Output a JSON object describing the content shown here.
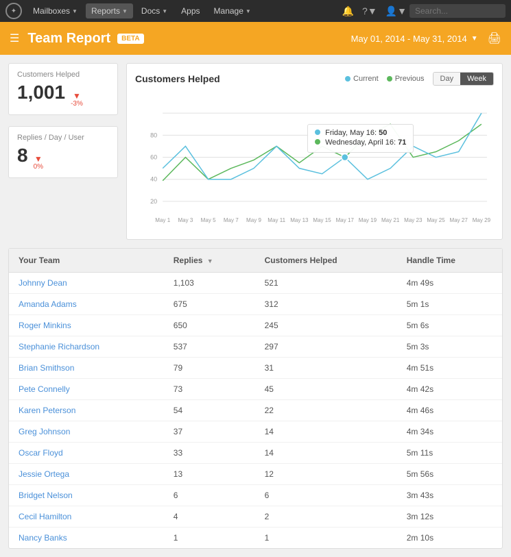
{
  "topnav": {
    "logo": "★",
    "items": [
      {
        "label": "Mailboxes",
        "arrow": true,
        "active": false
      },
      {
        "label": "Reports",
        "arrow": true,
        "active": true
      },
      {
        "label": "Docs",
        "arrow": true,
        "active": false
      },
      {
        "label": "Apps",
        "arrow": false,
        "active": false
      },
      {
        "label": "Manage",
        "arrow": true,
        "active": false
      }
    ],
    "search_placeholder": "Search..."
  },
  "subheader": {
    "title": "Team Report",
    "beta_label": "BETA",
    "date_range": "May 01, 2014 - May 31, 2014"
  },
  "stats": [
    {
      "label": "Customers Helped",
      "value": "1,001",
      "change": "-3%",
      "direction": "down"
    },
    {
      "label": "Replies / Day / User",
      "value": "8",
      "change": "0%",
      "direction": "down"
    }
  ],
  "chart": {
    "title": "Customers Helped",
    "legend": {
      "current_label": "Current",
      "previous_label": "Previous"
    },
    "toggle": {
      "day_label": "Day",
      "week_label": "Week",
      "active": "Week"
    },
    "x_labels": [
      "May 1",
      "May 3",
      "May 5",
      "May 7",
      "May 9",
      "May 11",
      "May 13",
      "May 15",
      "May 17",
      "May 19",
      "May 21",
      "May 23",
      "May 25",
      "May 27",
      "May 29"
    ],
    "y_labels": [
      "20",
      "40",
      "60",
      "80"
    ],
    "tooltip": {
      "current_label": "Friday, May 16:",
      "current_value": "50",
      "previous_label": "Wednesday, April 16:",
      "previous_value": "71"
    }
  },
  "team_table": {
    "headers": [
      "Your Team",
      "Replies",
      "Customers Helped",
      "Handle Time"
    ],
    "rows": [
      {
        "name": "Johnny Dean",
        "replies": "1,103",
        "customers": "521",
        "handle": "4m 49s"
      },
      {
        "name": "Amanda Adams",
        "replies": "675",
        "customers": "312",
        "handle": "5m 1s"
      },
      {
        "name": "Roger Minkins",
        "replies": "650",
        "customers": "245",
        "handle": "5m 6s"
      },
      {
        "name": "Stephanie Richardson",
        "replies": "537",
        "customers": "297",
        "handle": "5m 3s"
      },
      {
        "name": "Brian Smithson",
        "replies": "79",
        "customers": "31",
        "handle": "4m 51s"
      },
      {
        "name": "Pete Connelly",
        "replies": "73",
        "customers": "45",
        "handle": "4m 42s"
      },
      {
        "name": "Karen Peterson",
        "replies": "54",
        "customers": "22",
        "handle": "4m 46s"
      },
      {
        "name": "Greg Johnson",
        "replies": "37",
        "customers": "14",
        "handle": "4m 34s"
      },
      {
        "name": "Oscar Floyd",
        "replies": "33",
        "customers": "14",
        "handle": "5m 11s"
      },
      {
        "name": "Jessie Ortega",
        "replies": "13",
        "customers": "12",
        "handle": "5m 56s"
      },
      {
        "name": "Bridget Nelson",
        "replies": "6",
        "customers": "6",
        "handle": "3m 43s"
      },
      {
        "name": "Cecil Hamilton",
        "replies": "4",
        "customers": "2",
        "handle": "3m 12s"
      },
      {
        "name": "Nancy Banks",
        "replies": "1",
        "customers": "1",
        "handle": "2m 10s"
      }
    ]
  }
}
